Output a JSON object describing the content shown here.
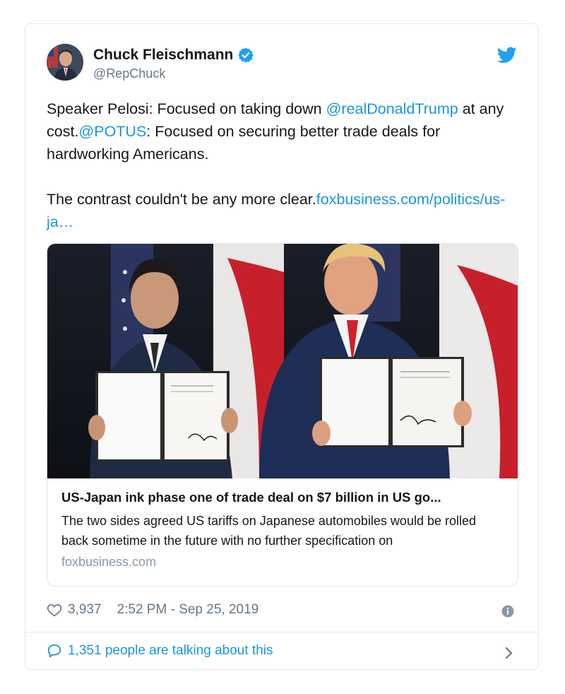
{
  "author": {
    "name": "Chuck Fleischmann",
    "handle": "@RepChuck",
    "verified": true
  },
  "tweet": {
    "text_1": "Speaker Pelosi: Focused on taking down ",
    "mention_1": "@realDonaldTrump",
    "text_2": " at any cost.",
    "mention_2": "@POTUS",
    "text_3": ": Focused on securing better trade deals for hardworking Americans.\n\nThe contrast couldn't be any more clear.",
    "link": "foxbusiness.com/politics/us-ja…"
  },
  "link_card": {
    "title": "US-Japan ink phase one of trade deal on $7 billion in US go...",
    "description": "The two sides agreed US tariffs on Japanese automobiles would be rolled back sometime in the future with no further specification on",
    "domain": "foxbusiness.com"
  },
  "meta": {
    "likes": "3,937",
    "timestamp": "2:52 PM - Sep 25, 2019"
  },
  "footer": {
    "talking": "1,351 people are talking about this"
  },
  "colors": {
    "link": "#1b95e0",
    "secondary": "#657786",
    "border": "#e1e8ed"
  },
  "icons": [
    "verified-badge-icon",
    "twitter-bird-icon",
    "heart-icon",
    "info-icon",
    "speech-bubble-icon",
    "chevron-right-icon"
  ]
}
